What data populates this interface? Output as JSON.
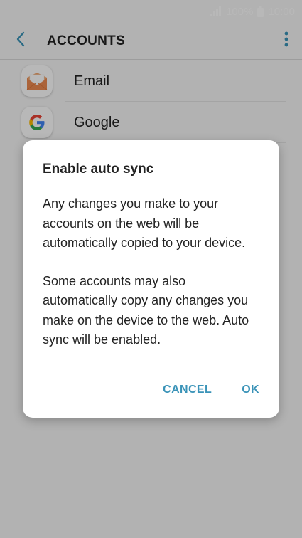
{
  "status_bar": {
    "battery_percent": "100%",
    "time": "10:00",
    "icons": [
      "signal-icon",
      "battery-icon"
    ]
  },
  "app_bar": {
    "title": "ACCOUNTS",
    "back_icon": "chevron-left-icon",
    "more_icon": "more-vert-icon"
  },
  "accounts": [
    {
      "label": "Email",
      "icon": "email-icon"
    },
    {
      "label": "Google",
      "icon": "google-icon"
    }
  ],
  "dialog": {
    "title": "Enable auto sync",
    "paragraph_1": "Any changes you make to your accounts on the web will be automatically copied to your device.",
    "paragraph_2": "Some accounts may also automatically copy any changes you make on the device to the web. Auto sync will be enabled.",
    "cancel_label": "CANCEL",
    "ok_label": "OK"
  },
  "colors": {
    "accent": "#3a93b8",
    "email_orange": "#ee8a4f",
    "background": "#f7f7f7"
  }
}
